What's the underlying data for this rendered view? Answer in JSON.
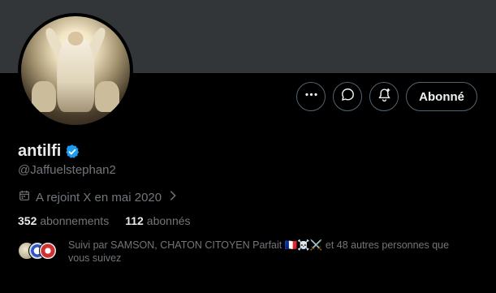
{
  "profile": {
    "name": "antilfi",
    "handle": "@Jaffuelstephan2",
    "joined": "A rejoint X en mai 2020"
  },
  "actions": {
    "follow_label": "Abonné"
  },
  "stats": {
    "following_count": "352",
    "following_label": "abonnements",
    "followers_count": "112",
    "followers_label": "abonnés"
  },
  "followed_by": {
    "line1": "Suivi par SAMSON, CHATON CITOYEN Parfait 🇫🇷☠️⚔️ et 48 autres personnes que",
    "line2": "vous suivez"
  },
  "icons": [
    "more-icon",
    "message-icon",
    "notify-icon",
    "verified-icon",
    "calendar-icon",
    "chevron-right-icon"
  ],
  "colors": {
    "background": "#000000",
    "banner": "#333639",
    "verified": "#1d9bf0",
    "muted": "#71767b"
  }
}
